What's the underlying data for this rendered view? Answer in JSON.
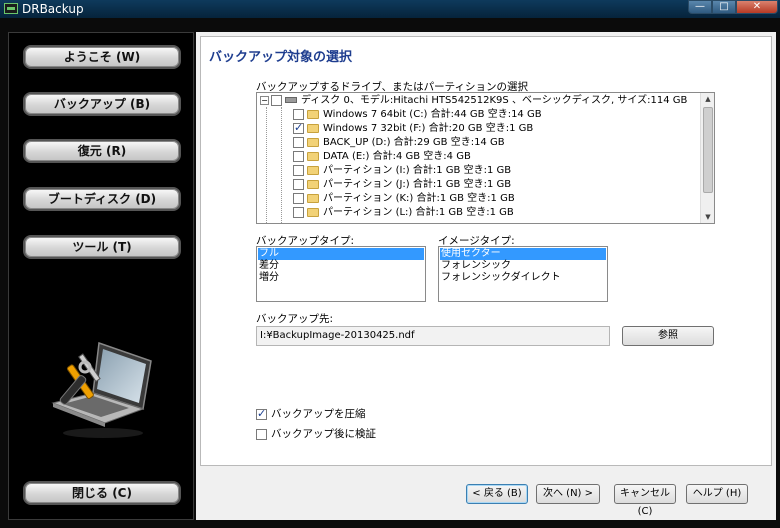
{
  "window": {
    "title": "DRBackup"
  },
  "sidebar": {
    "items": [
      {
        "label": "ようこそ (W)"
      },
      {
        "label": "バックアップ (B)"
      },
      {
        "label": "復元 (R)"
      },
      {
        "label": "ブートディスク (D)"
      },
      {
        "label": "ツール (T)"
      }
    ],
    "close_label": "閉じる (C)"
  },
  "main": {
    "title": "バックアップ対象の選択",
    "tree_label": "バックアップするドライブ、またはパーティションの選択",
    "tree": {
      "disk": "ディスク 0、モデル:Hitachi  HTS542512K9S      、ベーシックディスク, サイズ:114 GB",
      "partitions": [
        {
          "label": "Windows 7 64bit (C:) 合計:44 GB  空き:14 GB",
          "checked": false
        },
        {
          "label": "Windows 7 32bit (F:) 合計:20 GB  空き:1 GB",
          "checked": true
        },
        {
          "label": "BACK_UP (D:) 合計:29 GB  空き:14 GB",
          "checked": false
        },
        {
          "label": "DATA (E:) 合計:4 GB  空き:4 GB",
          "checked": false
        },
        {
          "label": "パーティション (I:) 合計:1 GB  空き:1 GB",
          "checked": false
        },
        {
          "label": "パーティション (J:) 合計:1 GB  空き:1 GB",
          "checked": false
        },
        {
          "label": "パーティション (K:) 合計:1 GB  空き:1 GB",
          "checked": false
        },
        {
          "label": "パーティション (L:) 合計:1 GB  空き:1 GB",
          "checked": false
        }
      ]
    },
    "backup_type": {
      "label": "バックアップタイプ:",
      "options": [
        "フル",
        "差分",
        "増分"
      ],
      "selected": "フル"
    },
    "image_type": {
      "label": "イメージタイプ:",
      "options": [
        "使用セクター",
        "フォレンシック",
        "フォレンシックダイレクト"
      ],
      "selected": "使用セクター"
    },
    "destination": {
      "label": "バックアップ先:",
      "value": "I:¥BackupImage-20130425.ndf",
      "browse_label": "参照"
    },
    "options": {
      "compress": {
        "label": "バックアップを圧縮",
        "checked": true
      },
      "verify": {
        "label": "バックアップ後に検証",
        "checked": false
      }
    }
  },
  "footer": {
    "back_label": "< 戻る (B)",
    "next_label": "次へ (N) >",
    "cancel_label": "キャンセル (C)",
    "help_label": "ヘルプ (H)"
  },
  "colors": {
    "title_blue": "#1e3d8f",
    "selection": "#3399ff"
  }
}
